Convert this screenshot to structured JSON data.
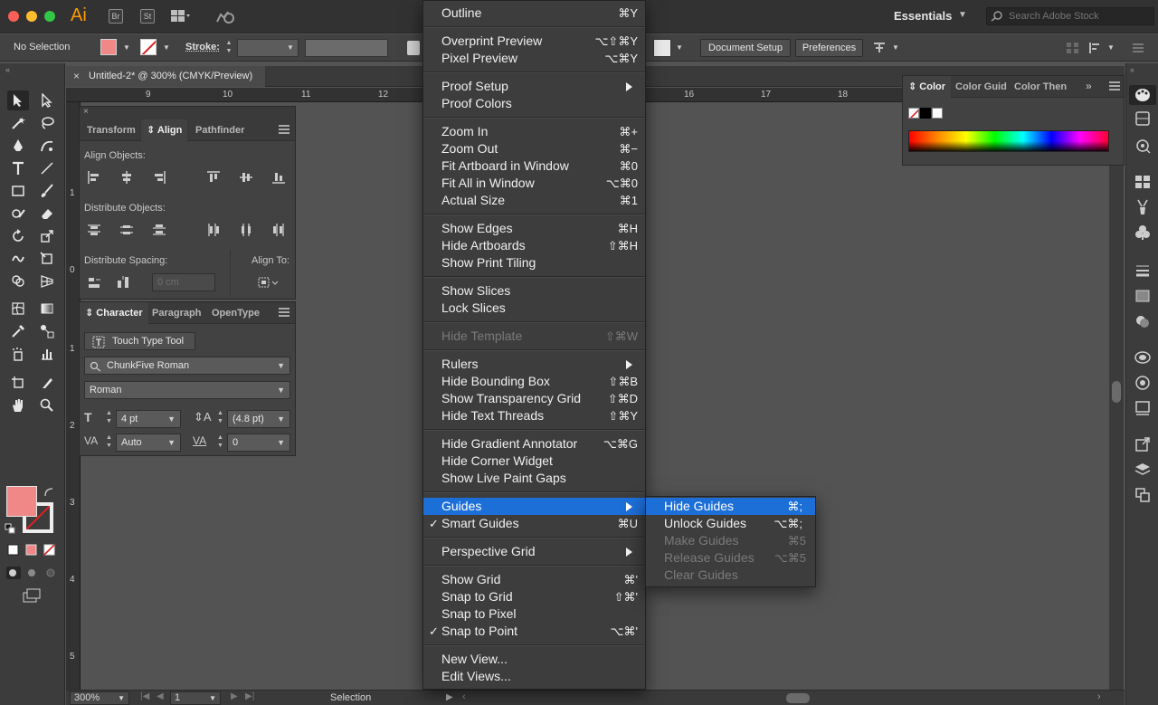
{
  "app": {
    "logo": "Ai",
    "bridge": "Br",
    "stock": "St",
    "workspace": "Essentials",
    "stock_search_placeholder": "Search Adobe Stock"
  },
  "control_bar": {
    "selection": "No Selection",
    "stroke_label": "Stroke:",
    "document_setup": "Document Setup",
    "preferences": "Preferences"
  },
  "document": {
    "tab_title": "Untitled-2* @ 300% (CMYK/Preview)",
    "ruler_h": [
      "9",
      "10",
      "11",
      "12",
      "16",
      "17",
      "18"
    ],
    "ruler_v": [
      "1",
      "0",
      "1",
      "2",
      "3",
      "4",
      "5"
    ]
  },
  "align_panel": {
    "tabs": [
      "Transform",
      "Align",
      "Pathfinder"
    ],
    "active_tab": "Align",
    "align_objects": "Align Objects:",
    "distribute_objects": "Distribute Objects:",
    "distribute_spacing": "Distribute Spacing:",
    "align_to": "Align To:",
    "spacing_value": "0 cm"
  },
  "character_panel": {
    "tabs": [
      "Character",
      "Paragraph",
      "OpenType"
    ],
    "active_tab": "Character",
    "touch_type": "Touch Type Tool",
    "font_family": "ChunkFive Roman",
    "font_style": "Roman",
    "font_size": "4 pt",
    "leading": "(4.8 pt)",
    "kerning": "Auto",
    "tracking": "0"
  },
  "color_panel": {
    "tabs": [
      "Color",
      "Color Guid",
      "Color Then"
    ]
  },
  "status_bar": {
    "zoom": "300%",
    "artboard": "1",
    "tool": "Selection"
  },
  "view_menu": {
    "items": [
      {
        "label": "Outline",
        "shortcut": "⌘Y"
      },
      {
        "label": "Overprint Preview",
        "shortcut": "⌥⇧⌘Y"
      },
      {
        "label": "Pixel Preview",
        "shortcut": "⌥⌘Y"
      },
      {
        "label": "Proof Setup",
        "shortcut": ""
      },
      {
        "label": "Proof Colors",
        "shortcut": ""
      },
      {
        "label": "Zoom In",
        "shortcut": "⌘+"
      },
      {
        "label": "Zoom Out",
        "shortcut": "⌘−"
      },
      {
        "label": "Fit Artboard in Window",
        "shortcut": "⌘0"
      },
      {
        "label": "Fit All in Window",
        "shortcut": "⌥⌘0"
      },
      {
        "label": "Actual Size",
        "shortcut": "⌘1"
      },
      {
        "label": "Show Edges",
        "shortcut": "⌘H"
      },
      {
        "label": "Hide Artboards",
        "shortcut": "⇧⌘H"
      },
      {
        "label": "Show Print Tiling",
        "shortcut": ""
      },
      {
        "label": "Show Slices",
        "shortcut": ""
      },
      {
        "label": "Lock Slices",
        "shortcut": ""
      },
      {
        "label": "Hide Template",
        "shortcut": "⇧⌘W"
      },
      {
        "label": "Rulers",
        "shortcut": ""
      },
      {
        "label": "Hide Bounding Box",
        "shortcut": "⇧⌘B"
      },
      {
        "label": "Show Transparency Grid",
        "shortcut": "⇧⌘D"
      },
      {
        "label": "Hide Text Threads",
        "shortcut": "⇧⌘Y"
      },
      {
        "label": "Hide Gradient Annotator",
        "shortcut": "⌥⌘G"
      },
      {
        "label": "Hide Corner Widget",
        "shortcut": ""
      },
      {
        "label": "Show Live Paint Gaps",
        "shortcut": ""
      },
      {
        "label": "Guides",
        "shortcut": ""
      },
      {
        "label": "Smart Guides",
        "shortcut": "⌘U"
      },
      {
        "label": "Perspective Grid",
        "shortcut": ""
      },
      {
        "label": "Show Grid",
        "shortcut": "⌘'"
      },
      {
        "label": "Snap to Grid",
        "shortcut": "⇧⌘'"
      },
      {
        "label": "Snap to Pixel",
        "shortcut": ""
      },
      {
        "label": "Snap to Point",
        "shortcut": "⌥⌘'"
      },
      {
        "label": "New View...",
        "shortcut": ""
      },
      {
        "label": "Edit Views...",
        "shortcut": ""
      }
    ],
    "check_mark": "✓"
  },
  "guides_submenu": {
    "items": [
      {
        "label": "Hide Guides",
        "shortcut": "⌘;"
      },
      {
        "label": "Unlock Guides",
        "shortcut": "⌥⌘;"
      },
      {
        "label": "Make Guides",
        "shortcut": "⌘5"
      },
      {
        "label": "Release Guides",
        "shortcut": "⌥⌘5"
      },
      {
        "label": "Clear Guides",
        "shortcut": ""
      }
    ]
  },
  "colors": {
    "menu_highlight": "#1d6fd8",
    "fill": "#f08888",
    "logo": "#ff9a00"
  }
}
